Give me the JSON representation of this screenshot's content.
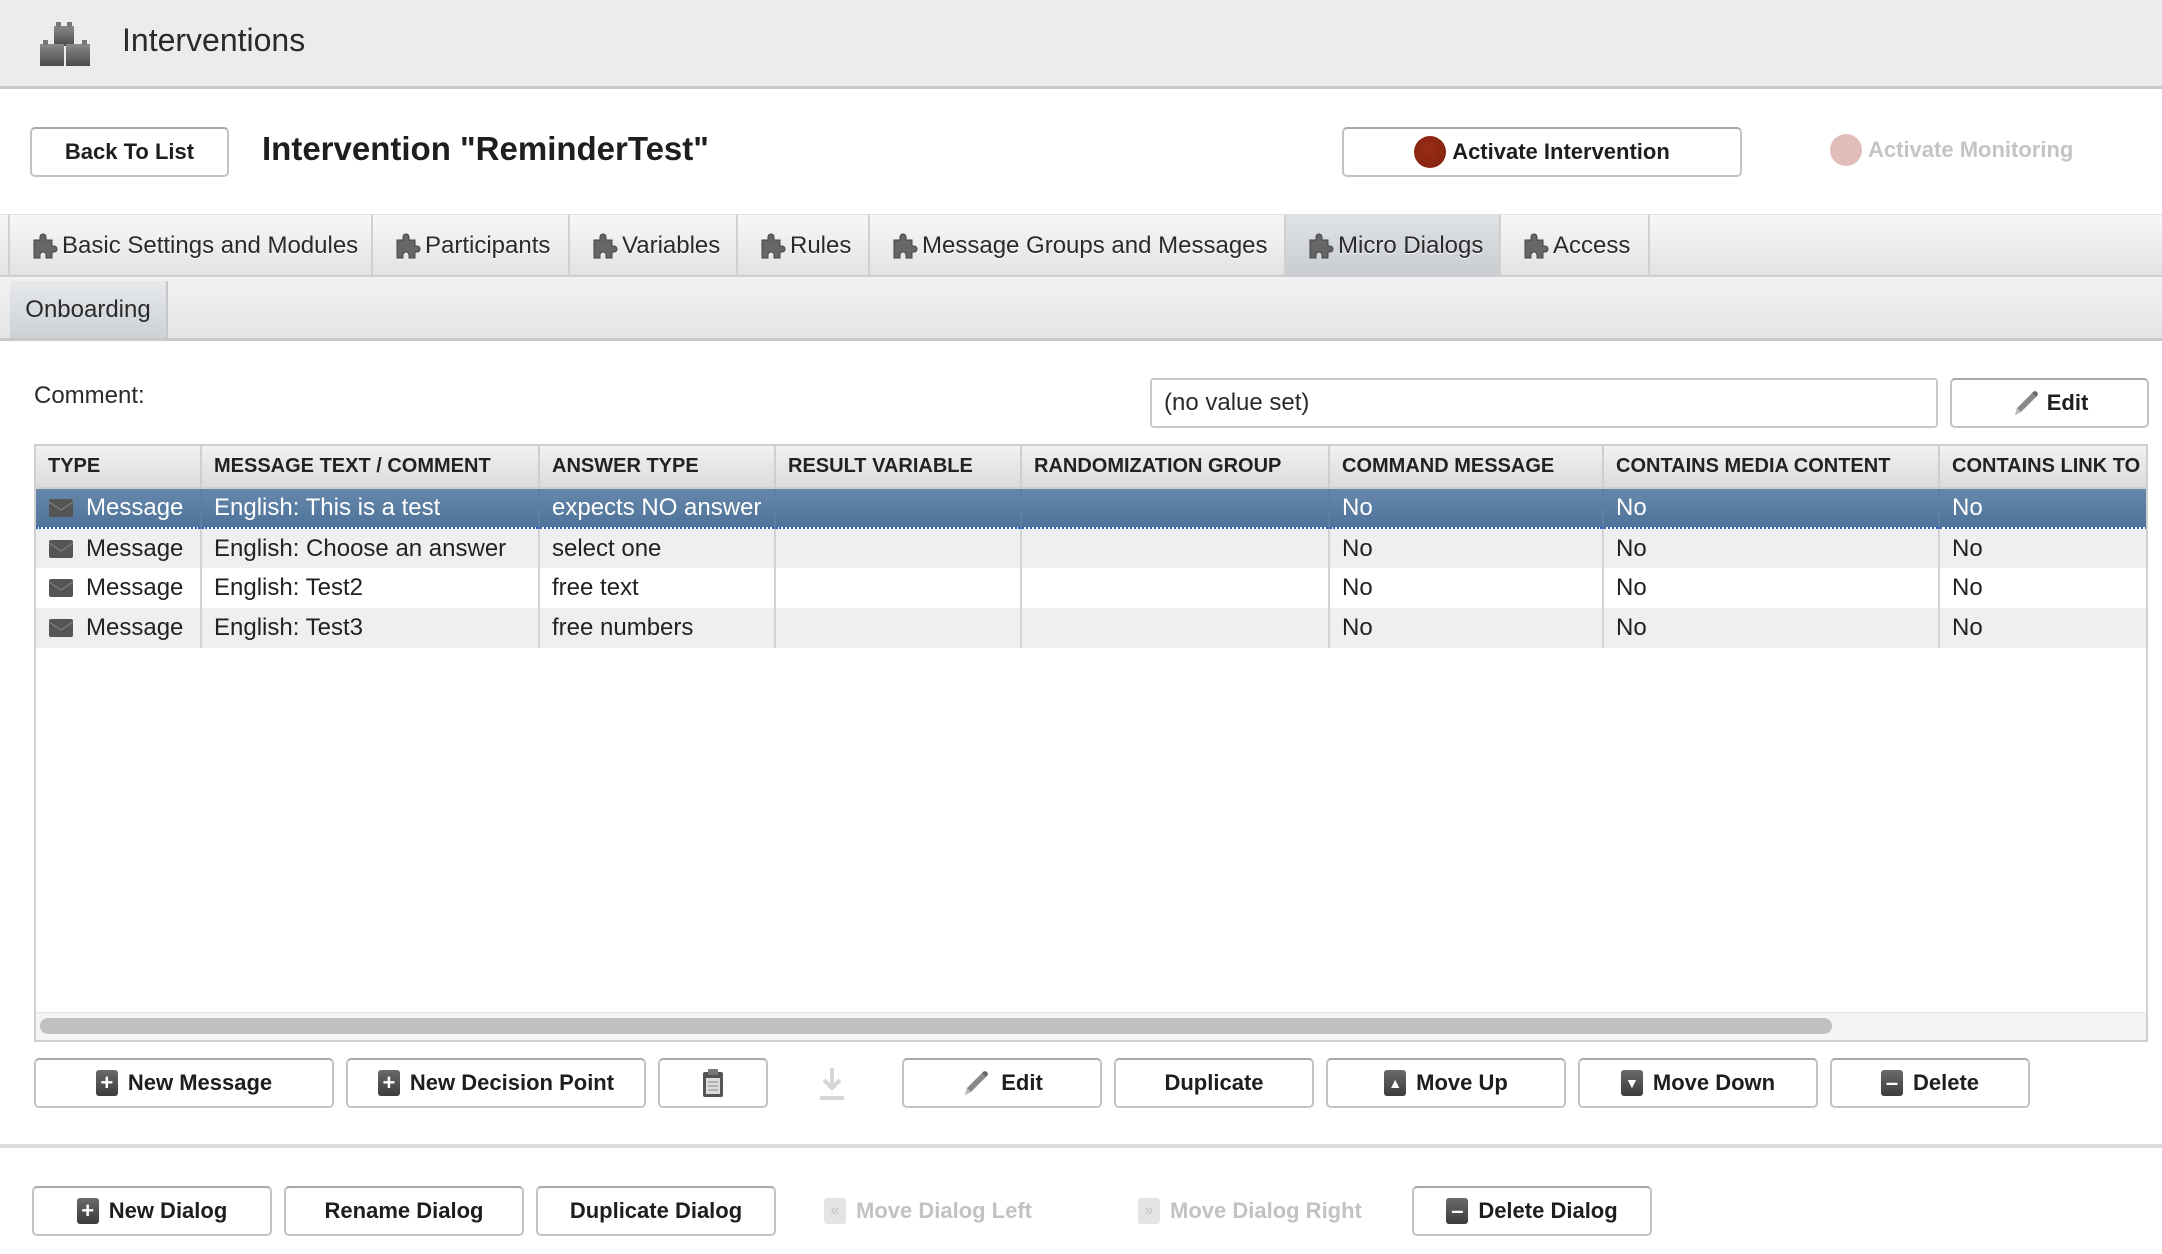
{
  "header": {
    "title": "Interventions",
    "logo_icon": "blocks-icon"
  },
  "toolbar": {
    "back_label": "Back To List",
    "page_title": "Intervention \"ReminderTest\"",
    "activate_intervention_label": "Activate Intervention",
    "activate_monitoring_label": "Activate Monitoring",
    "status_color_active": "#8a2612",
    "status_color_disabled": "#e0bdb8"
  },
  "tabs": [
    {
      "label": "Basic Settings and Modules",
      "active": false
    },
    {
      "label": "Participants",
      "active": false
    },
    {
      "label": "Variables",
      "active": false
    },
    {
      "label": "Rules",
      "active": false
    },
    {
      "label": "Message Groups and Messages",
      "active": false
    },
    {
      "label": "Micro Dialogs",
      "active": true
    },
    {
      "label": "Access",
      "active": false
    }
  ],
  "subtabs": [
    {
      "label": "Onboarding",
      "active": true
    }
  ],
  "comment": {
    "label": "Comment:",
    "value": "(no value set)",
    "edit_label": "Edit"
  },
  "table": {
    "columns": [
      "TYPE",
      "MESSAGE TEXT / COMMENT",
      "ANSWER TYPE",
      "RESULT VARIABLE",
      "RANDOMIZATION GROUP",
      "COMMAND MESSAGE",
      "CONTAINS MEDIA CONTENT",
      "CONTAINS LINK TO S"
    ],
    "rows": [
      {
        "type": "Message",
        "text": "English: This is a test",
        "answer_type": "expects NO answer",
        "result_variable": "",
        "randomization_group": "",
        "command": "No",
        "media": "No",
        "link": "No",
        "selected": true
      },
      {
        "type": "Message",
        "text": "English: Choose an answer",
        "answer_type": "select one",
        "result_variable": "",
        "randomization_group": "",
        "command": "No",
        "media": "No",
        "link": "No",
        "selected": false
      },
      {
        "type": "Message",
        "text": "English: Test2",
        "answer_type": "free text",
        "result_variable": "",
        "randomization_group": "",
        "command": "No",
        "media": "No",
        "link": "No",
        "selected": false
      },
      {
        "type": "Message",
        "text": "English: Test3",
        "answer_type": "free numbers",
        "result_variable": "",
        "randomization_group": "",
        "command": "No",
        "media": "No",
        "link": "No",
        "selected": false
      }
    ],
    "selection_color": "#5a7ca1"
  },
  "actions": {
    "new_message": "New Message",
    "new_decision_point": "New Decision Point",
    "edit": "Edit",
    "duplicate": "Duplicate",
    "move_up": "Move Up",
    "move_down": "Move Down",
    "delete": "Delete"
  },
  "dialog_actions": {
    "new_dialog": "New Dialog",
    "rename_dialog": "Rename Dialog",
    "duplicate_dialog": "Duplicate Dialog",
    "move_dialog_left": "Move Dialog Left",
    "move_dialog_right": "Move Dialog Right",
    "delete_dialog": "Delete Dialog"
  }
}
